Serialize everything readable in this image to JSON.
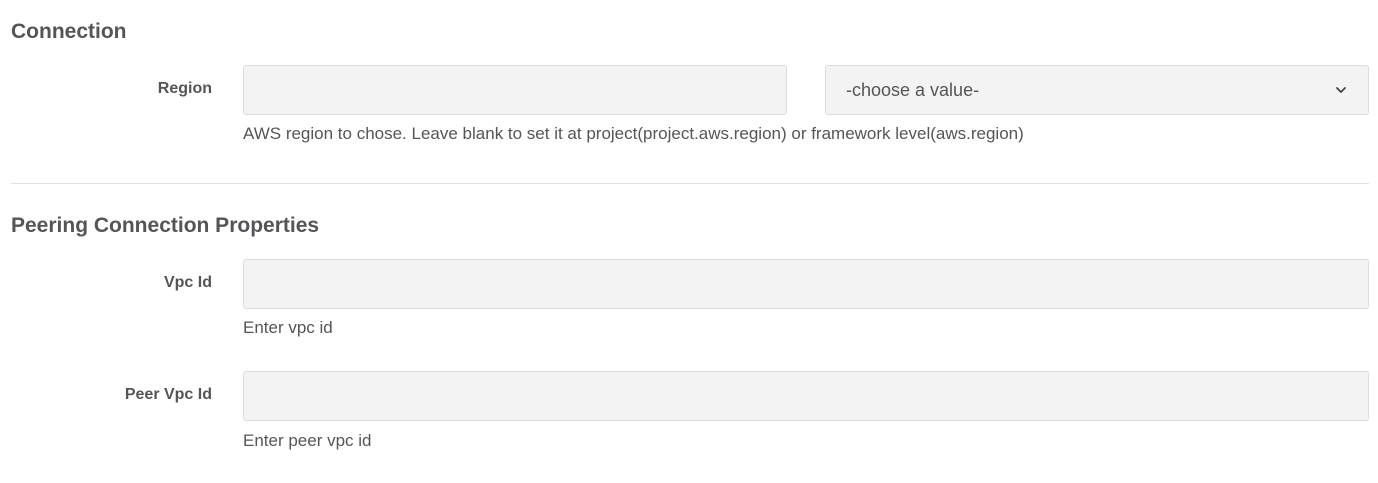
{
  "connection": {
    "title": "Connection",
    "region": {
      "label": "Region",
      "value": "",
      "placeholder": "",
      "select_value": "-choose a value-",
      "help": "AWS region to chose. Leave blank to set it at project(project.aws.region) or framework level(aws.region)"
    }
  },
  "peering": {
    "title": "Peering Connection Properties",
    "vpc_id": {
      "label": "Vpc Id",
      "value": "",
      "placeholder": "",
      "help": "Enter vpc id"
    },
    "peer_vpc_id": {
      "label": "Peer Vpc Id",
      "value": "",
      "placeholder": "",
      "help": "Enter peer vpc id"
    }
  },
  "icons": {
    "select_chevron": "chevron-down-icon"
  }
}
